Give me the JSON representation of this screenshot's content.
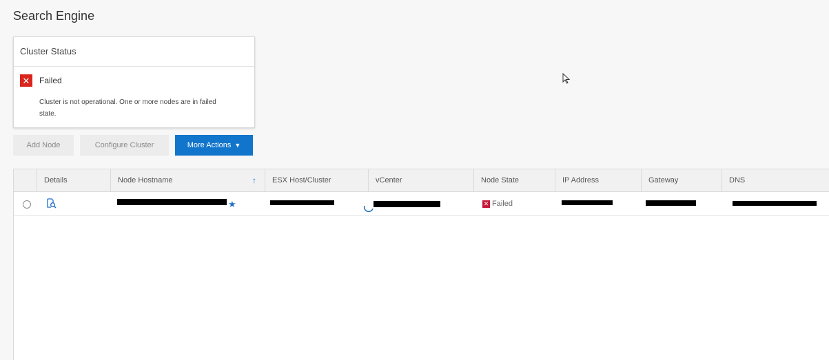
{
  "page": {
    "title": "Search Engine"
  },
  "cluster_status": {
    "title": "Cluster Status",
    "state": "Failed",
    "message": "Cluster is not operational. One or more nodes are in failed state."
  },
  "actions": {
    "add_node": "Add Node",
    "configure_cluster": "Configure Cluster",
    "more_actions": "More Actions"
  },
  "grid": {
    "columns": [
      "Details",
      "Node Hostname",
      "ESX Host/Cluster",
      "vCenter",
      "Node State",
      "IP Address",
      "Gateway",
      "DNS"
    ],
    "rows": [
      {
        "node_state": "Failed"
      }
    ]
  },
  "colors": {
    "primary": "#1275cc",
    "failed": "#d9251c",
    "state_failed": "#c6183a"
  }
}
